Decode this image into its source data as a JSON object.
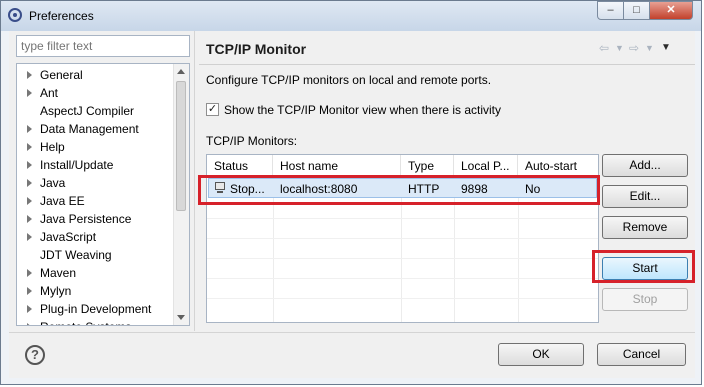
{
  "window": {
    "title": "Preferences"
  },
  "sidebar": {
    "filter_placeholder": "type filter text",
    "items": [
      {
        "label": "General",
        "expandable": true
      },
      {
        "label": "Ant",
        "expandable": true
      },
      {
        "label": "AspectJ Compiler",
        "expandable": false
      },
      {
        "label": "Data Management",
        "expandable": true
      },
      {
        "label": "Help",
        "expandable": true
      },
      {
        "label": "Install/Update",
        "expandable": true
      },
      {
        "label": "Java",
        "expandable": true
      },
      {
        "label": "Java EE",
        "expandable": true
      },
      {
        "label": "Java Persistence",
        "expandable": true
      },
      {
        "label": "JavaScript",
        "expandable": true
      },
      {
        "label": "JDT Weaving",
        "expandable": false
      },
      {
        "label": "Maven",
        "expandable": true
      },
      {
        "label": "Mylyn",
        "expandable": true
      },
      {
        "label": "Plug-in Development",
        "expandable": true
      },
      {
        "label": "Remote Systems",
        "expandable": true
      }
    ]
  },
  "page": {
    "title": "TCP/IP Monitor",
    "description": "Configure TCP/IP monitors on local and remote ports.",
    "show_view_checkbox": {
      "label": "Show the TCP/IP Monitor view when there is activity",
      "checked": true
    },
    "monitors_label": "TCP/IP Monitors:",
    "table": {
      "columns": [
        "Status",
        "Host name",
        "Type",
        "Local P...",
        "Auto-start"
      ],
      "rows": [
        {
          "status": "Stop...",
          "host": "localhost:8080",
          "type": "HTTP",
          "local_port": "9898",
          "auto_start": "No"
        }
      ]
    },
    "buttons": {
      "add": "Add...",
      "edit": "Edit...",
      "remove": "Remove",
      "start": "Start",
      "stop": "Stop"
    }
  },
  "footer": {
    "ok": "OK",
    "cancel": "Cancel"
  },
  "icons": {
    "app": "eclipse-icon",
    "minimize": "minimize-icon",
    "maximize": "maximize-icon",
    "close": "close-icon",
    "back": "back-arrow-icon",
    "forward": "forward-arrow-icon",
    "menu": "view-menu-icon",
    "help": "help-icon",
    "monitor": "monitor-icon"
  },
  "colors": {
    "highlight": "#d6212a",
    "selection": "#dbe9f8"
  }
}
